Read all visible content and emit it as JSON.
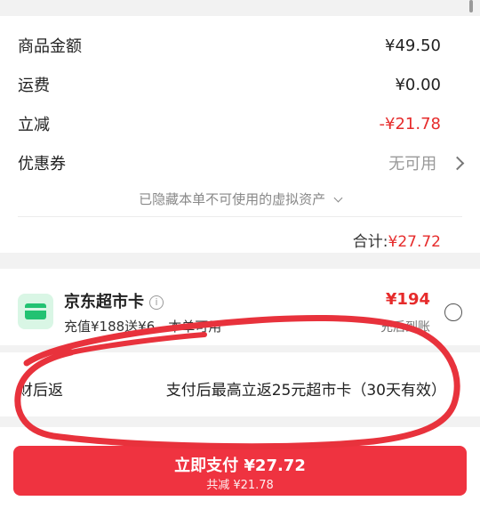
{
  "summary": {
    "items": [
      {
        "label": "商品金额",
        "value": "¥49.50",
        "style": "normal"
      },
      {
        "label": "运费",
        "value": "¥0.00",
        "style": "normal"
      },
      {
        "label": "立减",
        "value": "-¥21.78",
        "style": "red"
      },
      {
        "label": "优惠券",
        "value": "无可用",
        "style": "gray"
      }
    ],
    "hidden_assets_note": "已隐藏本单不可使用的虚拟资产",
    "total_label": "合计:",
    "total_value": "¥27.72"
  },
  "supermarket_card": {
    "title": "京东超市卡",
    "info_icon": "info-icon",
    "subtitle": "充值¥188送¥6，本单可用",
    "price": "¥194",
    "recharge_note": "充后到账"
  },
  "rebate": {
    "label": "财后返",
    "text": "支付后最高立返25元超市卡（30天有效）"
  },
  "pay_button": {
    "label": "立即支付 ¥27.72",
    "savings": "共减 ¥21.78"
  },
  "colors": {
    "accent_red": "#ef3340",
    "price_red": "#e62b2b",
    "annotation_red": "#e8323c",
    "card_green": "#22c272"
  }
}
